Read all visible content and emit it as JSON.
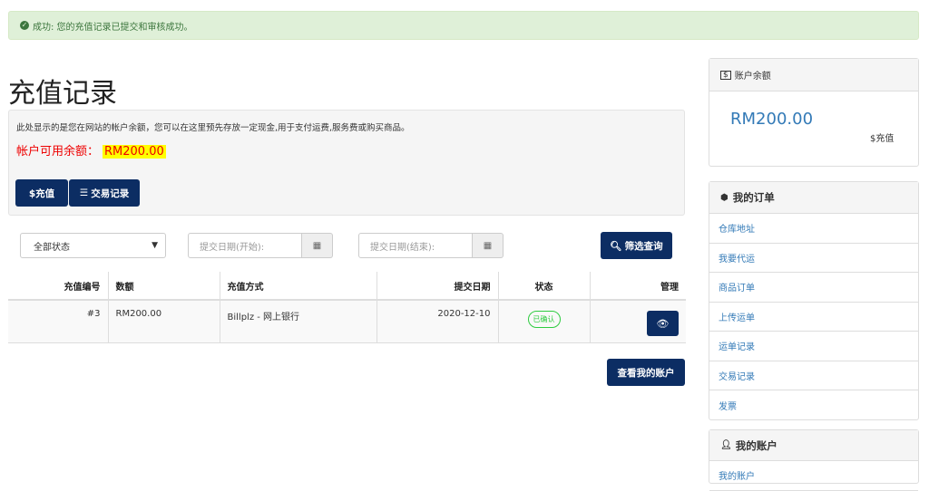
{
  "alert": {
    "icon": "check-circle-icon",
    "text": "成功:  您的充值记录已提交和审核成功。"
  },
  "page": {
    "title": "充值记录"
  },
  "info": {
    "description": "此处显示的是您在网站的帐户余额，您可以在这里预先存放一定现金,用于支付运费,服务费或购买商品。",
    "balance_label": "帐户可用余额：",
    "balance_value": "RM200.00"
  },
  "buttons": {
    "recharge": "$充值",
    "transactions": "交易记录",
    "filter": "筛选查询",
    "view_account": "查看我的账户"
  },
  "filters": {
    "status_selected": "全部状态",
    "date_start_placeholder": "提交日期(开始):",
    "date_end_placeholder": "提交日期(结束):"
  },
  "table": {
    "headers": [
      "充值编号",
      "数额",
      "充值方式",
      "提交日期",
      "状态",
      "管理"
    ],
    "rows": [
      {
        "id": "#3",
        "amount": "RM200.00",
        "method": "Billplz - 网上银行",
        "date": "2020-12-10",
        "status": "已确认"
      }
    ]
  },
  "sidebar": {
    "balance_title": "账户余额",
    "balance_amount": "RM200.00",
    "recharge_link": "$充值",
    "orders_title": "我的订单",
    "orders_items": [
      "仓库地址",
      "我要代运",
      "商品订单",
      "上传运单",
      "运单记录",
      "交易记录",
      "发票"
    ],
    "account_title": "我的账户",
    "account_items": [
      "我的账户"
    ]
  },
  "colors": {
    "primary": "#0c2d63",
    "success": "#2ecc40",
    "alert_bg": "#dff0d8",
    "link": "#337ab7",
    "balance_red": "#ee0000"
  }
}
